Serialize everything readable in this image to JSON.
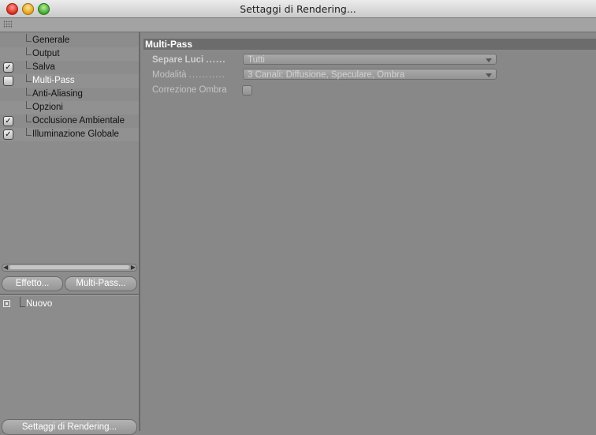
{
  "window": {
    "title": "Settaggi di Rendering..."
  },
  "sidebar": {
    "items": [
      {
        "label": "Generale",
        "checkbox": "none"
      },
      {
        "label": "Output",
        "checkbox": "none"
      },
      {
        "label": "Salva",
        "checkbox": "checked"
      },
      {
        "label": "Multi-Pass",
        "checkbox": "unchecked",
        "selected": true
      },
      {
        "label": "Anti-Aliasing",
        "checkbox": "none"
      },
      {
        "label": "Opzioni",
        "checkbox": "none"
      },
      {
        "label": "Occlusione Ambientale",
        "checkbox": "checked"
      },
      {
        "label": "Illuminazione Globale",
        "checkbox": "checked"
      }
    ],
    "effect_button": "Effetto...",
    "multipass_button": "Multi-Pass...",
    "nuovo_label": "Nuovo",
    "bottom_button": "Settaggi di Rendering..."
  },
  "main": {
    "section_title": "Multi-Pass",
    "fields": {
      "separe_luci": {
        "label": "Separe Luci",
        "dots": "......",
        "value": "Tutti"
      },
      "modalita": {
        "label": "Modalità",
        "dots": "...........",
        "value": "3 Canali: Diffusione, Speculare, Ombra"
      },
      "correzione_ombra": {
        "label": "Correzione Ombra",
        "checked": false
      }
    }
  },
  "colors": {
    "panel_bg": "#888888",
    "section_header": "#6c6c6c",
    "label_text": "#c4c4c4"
  }
}
